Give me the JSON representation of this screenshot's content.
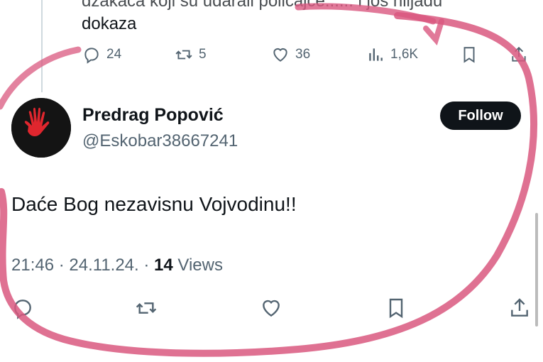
{
  "previous_tweet": {
    "text_line1": "džakaća koji su udarali policajce...... i još hiljadu",
    "text_line2": "dokaza",
    "replies": "24",
    "retweets": "5",
    "likes": "36",
    "views": "1,6K"
  },
  "tweet": {
    "display_name": "Predrag Popović",
    "handle": "@Eskobar38667241",
    "follow_label": "Follow",
    "text": "Daće Bog nezavisnu Vojvodinu!!",
    "time": "21:46 · 24.11.24. · ",
    "views_count": "14",
    "views_label": " Views"
  },
  "colors": {
    "accent_dark": "#0f1419",
    "secondary_text": "#536471",
    "annotation_pink": "#d9587f",
    "hand_red": "#e0262e"
  },
  "icons": [
    "reply-icon",
    "retweet-icon",
    "like-icon",
    "views-icon",
    "bookmark-icon",
    "share-icon",
    "red-hand-avatar"
  ]
}
